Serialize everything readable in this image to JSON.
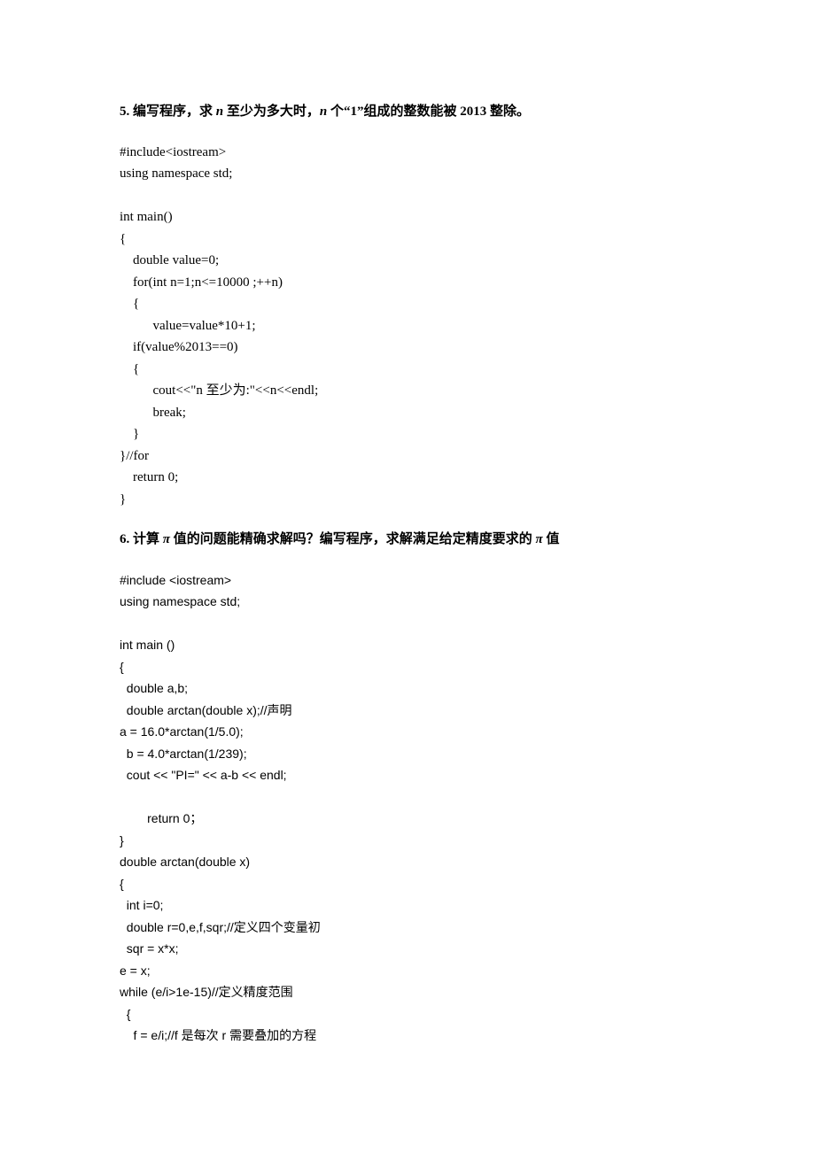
{
  "problem5": {
    "heading_prefix": "5.  编写程序，求 ",
    "heading_n": "n",
    "heading_mid": " 至少为多大时，",
    "heading_n2": "n",
    "heading_suffix": " 个“1”组成的整数能被 2013 整除。",
    "code": "#include<iostream>\nusing namespace std;\n\nint main()\n{\n    double value=0;\n    for(int n=1;n<=10000 ;++n)\n    {\n          value=value*10+1;\n    if(value%2013==0)\n    {\n          cout<<\"n 至少为:\"<<n<<endl;\n          break;\n    }\n}//for\n    return 0;\n}"
  },
  "problem6": {
    "heading_prefix": "6.  计算 ",
    "heading_pi": "π",
    "heading_mid": " 值的问题能精确求解吗？编写程序，求解满足给定精度要求的 ",
    "heading_pi2": "π",
    "heading_suffix": " 值",
    "code": "#include <iostream>\nusing namespace std;\n\nint main ()\n{\n  double a,b;\n  double arctan(double x);//声明\na = 16.0*arctan(1/5.0);\n  b = 4.0*arctan(1/239);\n  cout << \"PI=\" << a-b << endl;\n\n        return 0；\n}\ndouble arctan(double x)\n{\n  int i=0;\n  double r=0,e,f,sqr;//定义四个变量初\n  sqr = x*x;\ne = x;\nwhile (e/i>1e-15)//定义精度范围\n  {\n    f = e/i;//f 是每次 r 需要叠加的方程"
  }
}
